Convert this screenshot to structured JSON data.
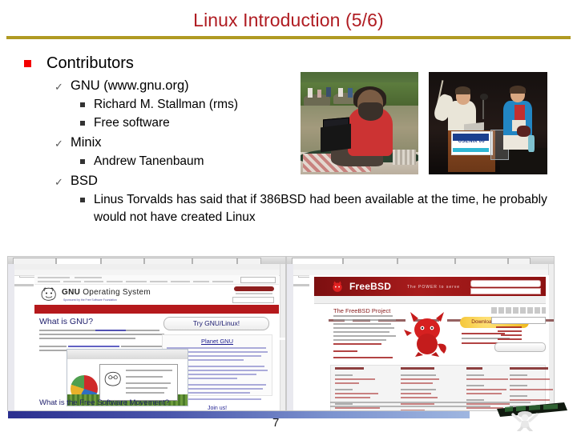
{
  "slide": {
    "title": "Linux Introduction (5/6)",
    "page_number": "7",
    "title_color": "#b01c22",
    "rule_color": "#b09a22",
    "bullet1_color": "#f40000",
    "footer_gradient_start": "#2b2f8f",
    "footer_gradient_end": "#9fb6e0"
  },
  "content": {
    "heading": "Contributors",
    "items": [
      {
        "label": "GNU (www.gnu.org)",
        "marker": "check-icon",
        "children": [
          {
            "label": "Richard M. Stallman (rms)",
            "marker": "square-bullet-icon"
          },
          {
            "label": "Free software",
            "marker": "square-bullet-icon"
          }
        ]
      },
      {
        "label": "Minix",
        "marker": "check-icon",
        "children": [
          {
            "label": "Andrew Tanenbaum",
            "marker": "square-bullet-icon"
          }
        ]
      },
      {
        "label": "BSD",
        "marker": "check-icon",
        "children": [
          {
            "label": "Linus Torvalds has said that if 386BSD had been available at the time, he probably would not have created Linux",
            "marker": "square-bullet-icon"
          }
        ]
      }
    ]
  },
  "photos": [
    {
      "name": "richard-stallman-boat-photo",
      "caption": "Richard Stallman using a laptop on a boat"
    },
    {
      "name": "usenix-06-conference-photo",
      "caption": "USENIX '06",
      "sign_text": "USENIX'06"
    }
  ],
  "screenshots": {
    "gnu": {
      "name": "gnu-org-website-screenshot",
      "logo_text": "GNU",
      "logo_suffix": " Operating System",
      "logo_sub": "Sponsored by the Free Software Foundation",
      "h1": "What is GNU?",
      "h2": "What is the Free Software Movement?",
      "try_button": "Try GNU/Linux!",
      "sidebar_title": "Planet GNU",
      "sidebar_title2": "Join us!"
    },
    "freebsd": {
      "name": "freebsd-org-website-screenshot",
      "logo_text": "FreeBSD",
      "tagline": "The POWER to serve",
      "h1": "The FreeBSD Project",
      "download_button": "Download FreeBSD"
    }
  },
  "mascot": {
    "name": "mascot-figure-with-banner"
  }
}
